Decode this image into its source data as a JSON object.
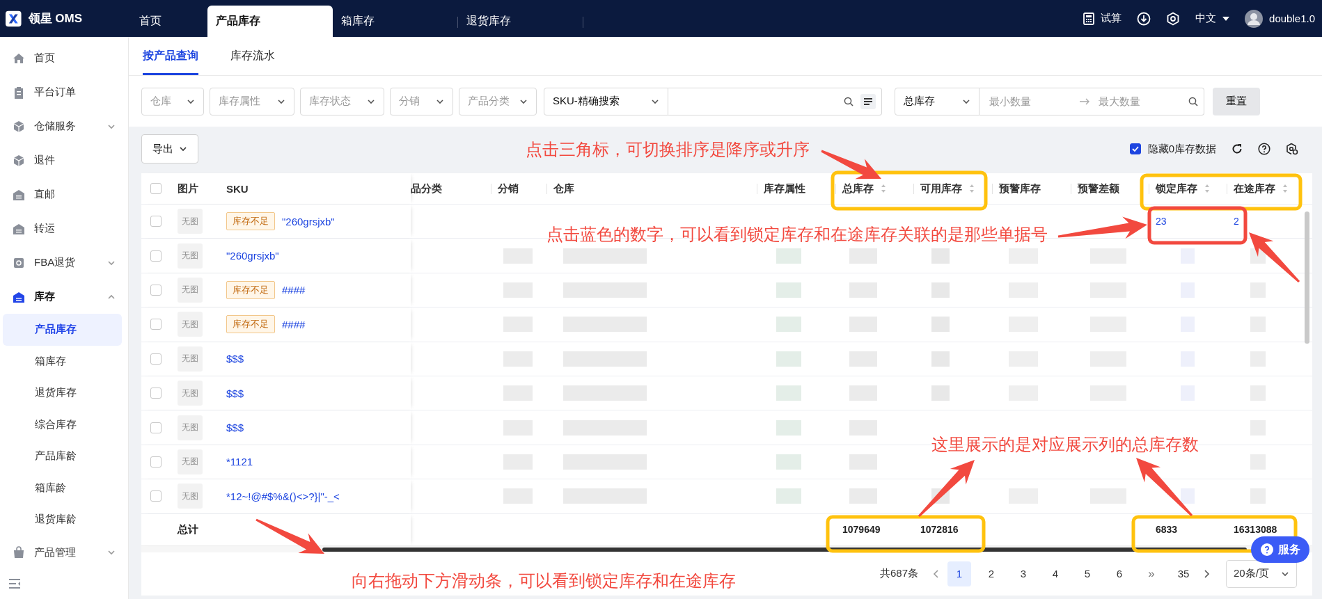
{
  "app": {
    "name": "领星 OMS"
  },
  "top_tabs": [
    {
      "label": "首页",
      "selected": false
    },
    {
      "label": "产品库存",
      "selected": true
    },
    {
      "label": "箱库存",
      "selected": false
    },
    {
      "label": "退货库存",
      "selected": false
    }
  ],
  "top_actions": {
    "trial": "试算",
    "language": "中文",
    "user": "double1.0"
  },
  "sidebar": {
    "items": [
      {
        "label": "首页",
        "kind": "link",
        "selected": false
      },
      {
        "label": "平台订单",
        "kind": "link",
        "selected": false
      },
      {
        "label": "仓储服务",
        "kind": "group",
        "selected": false,
        "expanded": false
      },
      {
        "label": "退件",
        "kind": "link",
        "selected": false
      },
      {
        "label": "直邮",
        "kind": "link",
        "selected": false
      },
      {
        "label": "转运",
        "kind": "link",
        "selected": false
      },
      {
        "label": "FBA退货",
        "kind": "group",
        "selected": false,
        "expanded": false
      },
      {
        "label": "库存",
        "kind": "group",
        "selected": true,
        "expanded": true,
        "children": [
          {
            "label": "产品库存",
            "selected": true
          },
          {
            "label": "箱库存",
            "selected": false
          },
          {
            "label": "退货库存",
            "selected": false
          },
          {
            "label": "综合库存",
            "selected": false
          },
          {
            "label": "产品库龄",
            "selected": false
          },
          {
            "label": "箱库龄",
            "selected": false
          },
          {
            "label": "退货库龄",
            "selected": false
          }
        ]
      },
      {
        "label": "产品管理",
        "kind": "group",
        "selected": false,
        "expanded": false
      }
    ]
  },
  "sub_tabs": [
    {
      "label": "按产品查询",
      "selected": true
    },
    {
      "label": "库存流水",
      "selected": false
    }
  ],
  "filters": [
    {
      "kind": "select",
      "placeholder": "仓库"
    },
    {
      "kind": "select",
      "placeholder": "库存属性"
    },
    {
      "kind": "select",
      "placeholder": "库存状态"
    },
    {
      "kind": "select",
      "placeholder": "分销"
    },
    {
      "kind": "select",
      "placeholder": "产品分类"
    },
    {
      "kind": "search",
      "mode": "SKU-精确搜索"
    },
    {
      "kind": "range",
      "field": "总库存",
      "min_placeholder": "最小数量",
      "max_placeholder": "最大数量"
    },
    {
      "kind": "button",
      "label": "重置"
    }
  ],
  "toolbar": {
    "export": "导出",
    "hide_zero": {
      "label": "隐藏0库存数据",
      "checked": true
    }
  },
  "table": {
    "select_all": {
      "checked": false
    },
    "columns": [
      {
        "label": "图片",
        "sortable": false
      },
      {
        "label": "SKU",
        "sortable": false
      },
      {
        "label": "品分类",
        "sortable": false
      },
      {
        "label": "分销",
        "sortable": false
      },
      {
        "label": "仓库",
        "sortable": false
      },
      {
        "label": "库存属性",
        "sortable": false
      },
      {
        "label": "总库存",
        "sortable": true
      },
      {
        "label": "可用库存",
        "sortable": true
      },
      {
        "label": "预警库存",
        "sortable": false
      },
      {
        "label": "预警差额",
        "sortable": false
      },
      {
        "label": "锁定库存",
        "sortable": true
      },
      {
        "label": "在途库存",
        "sortable": true
      }
    ],
    "rows": [
      {
        "checked": false,
        "image": "无图",
        "tag": "库存不足",
        "sku": "\"260grsjxb\"",
        "locked": "23",
        "in_transit": "2"
      },
      {
        "checked": false,
        "image": "无图",
        "sku": "\"260grsjxb\""
      },
      {
        "checked": false,
        "image": "无图",
        "tag": "库存不足",
        "sku": "####"
      },
      {
        "checked": false,
        "image": "无图",
        "tag": "库存不足",
        "sku": "####"
      },
      {
        "checked": false,
        "image": "无图",
        "sku": "$$$"
      },
      {
        "checked": false,
        "image": "无图",
        "sku": "$$$"
      },
      {
        "checked": false,
        "image": "无图",
        "sku": "$$$"
      },
      {
        "checked": false,
        "image": "无图",
        "sku": "*1121"
      },
      {
        "checked": false,
        "image": "无图",
        "sku": "*12~!@#$%&()<>?}|\"-_<"
      }
    ],
    "summary": {
      "label": "总计",
      "total_stock": "1079649",
      "available_stock": "1072816",
      "locked_stock": "6833",
      "in_transit_stock": "16313088"
    }
  },
  "pagination": {
    "total": "共687条",
    "pages": [
      {
        "label": "1",
        "kind": "page",
        "selected": true
      },
      {
        "label": "2",
        "kind": "page",
        "selected": false
      },
      {
        "label": "3",
        "kind": "page",
        "selected": false
      },
      {
        "label": "4",
        "kind": "page",
        "selected": false
      },
      {
        "label": "5",
        "kind": "page",
        "selected": false
      },
      {
        "label": "6",
        "kind": "page",
        "selected": false
      },
      {
        "label": "»",
        "kind": "jump",
        "selected": false
      },
      {
        "label": "35",
        "kind": "page",
        "selected": false
      }
    ],
    "page_size": "20条/页"
  },
  "service_button": "服务",
  "annotations": [
    {
      "text": "点击三角标，可切换排序是降序或升序"
    },
    {
      "text": "点击蓝色的数字，可以看到锁定库存和在途库存关联的是那些单据号"
    },
    {
      "text": "这里展示的是对应展示列的总库存数"
    },
    {
      "text": "向右拖动下方滑动条，可以看到锁定库存和在途库存"
    }
  ]
}
